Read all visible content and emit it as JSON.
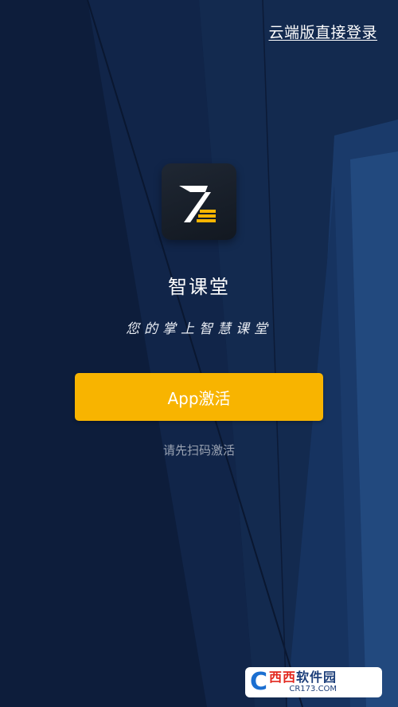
{
  "header": {
    "cloud_login_label": "云端版直接登录"
  },
  "app": {
    "name": "智课堂",
    "slogan": "您的掌上智慧课堂",
    "logo_icon": "zhiketang-logo-icon"
  },
  "actions": {
    "activate_label": "App激活",
    "hint": "请先扫码激活"
  },
  "watermark": {
    "brand": "西西软件园",
    "brand_red": "西西",
    "brand_dark": "软件园",
    "domain": "CR173.COM",
    "letter": "C"
  },
  "colors": {
    "background": "#0f2142",
    "accent": "#f8b400",
    "text_primary": "#ffffff",
    "text_hint": "#9aa3b2"
  }
}
